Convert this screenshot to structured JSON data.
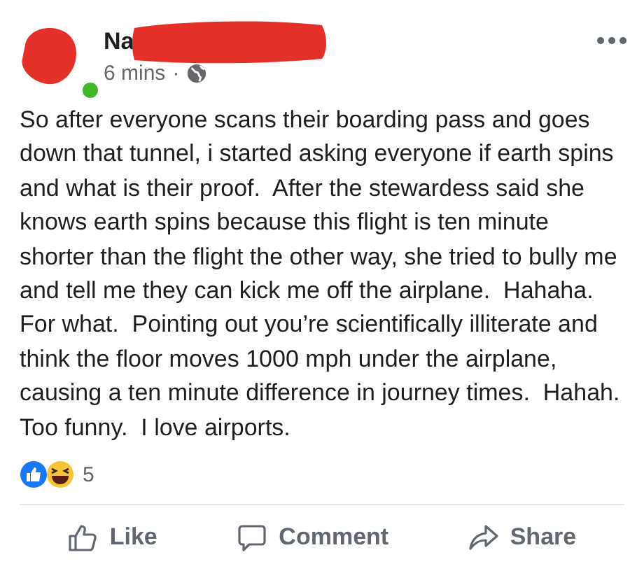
{
  "post": {
    "author": {
      "name": "Na",
      "online": true
    },
    "time": "6 mins",
    "separator": "·",
    "text": "So after everyone scans their boarding pass and goes down that tunnel, i started asking everyone if earth spins and what is their proof.  After the stewardess said she knows earth spins because this flight is ten minute shorter than the flight the other way, she tried to bully me and tell me they can kick me off the airplane.  Hahaha.  For what.  Pointing out you’re scientifically illiterate and think the floor moves 1000 mph under the airplane, causing a ten minute difference in journey times.  Hahah.  Too funny.  I love airports.",
    "reaction_count": "5",
    "actions": [
      {
        "kind": "like",
        "label": "Like"
      },
      {
        "kind": "comment",
        "label": "Comment"
      },
      {
        "kind": "share",
        "label": "Share"
      }
    ]
  }
}
